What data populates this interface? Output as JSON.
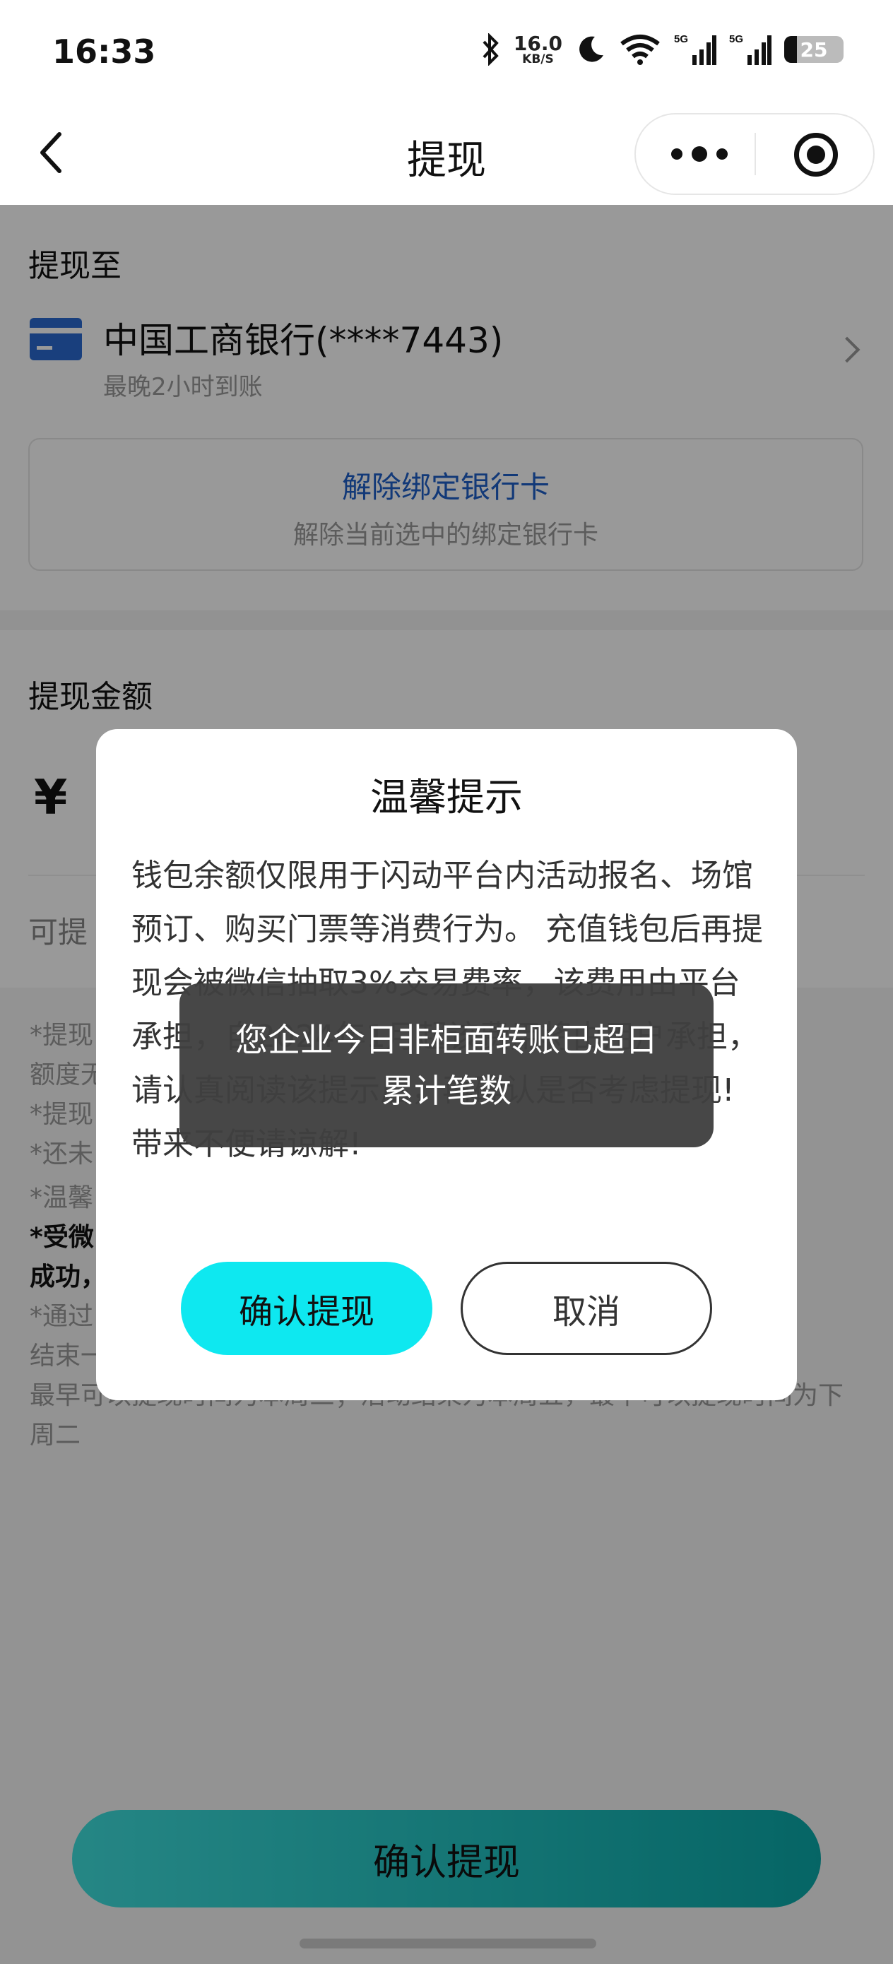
{
  "status_bar": {
    "time": "16:33",
    "net_speed_value": "16.0",
    "net_speed_unit": "KB/S",
    "signal_1": "5G",
    "signal_2": "5G",
    "battery": "25"
  },
  "nav": {
    "title": "提现"
  },
  "withdraw_to": {
    "section_title": "提现至",
    "bank_name": "中国工商银行(****7443)",
    "arrival": "最晚2小时到账",
    "unbind_title": "解除绑定银行卡",
    "unbind_desc": "解除当前选中的绑定银行卡"
  },
  "amount": {
    "section_title": "提现金额",
    "symbol": "¥",
    "available_label": "可提"
  },
  "notes": [
    "*提现",
    "额度无",
    "*提现",
    "*还未",
    "*温馨",
    "*受微",
    "成功，",
    "*通过",
    "结束一",
    "最早可以提现时间为本周三；活动结束为本周五，最早可以提现时间为下周二"
  ],
  "bottom_button": "确认提现",
  "dialog": {
    "title": "温馨提示",
    "body": "钱包余额仅限用于闪动平台内活动报名、场馆预订、购买门票等消费行为。 充值钱包后再提现会被微信抽取3%交易费率，该费用由平台承担，自2024年1月起该费用将由用户承担，请认真阅读该提示后，再确认是否考虑提现! 带来不便请谅解!",
    "confirm": "确认提现",
    "cancel": "取消"
  },
  "toast": "您企业今日非柜面转账已超日累计笔数",
  "colors": {
    "accent_cyan": "#0ee8f0",
    "link_blue": "#1f5fc8",
    "card_blue": "#2a6ad0"
  }
}
